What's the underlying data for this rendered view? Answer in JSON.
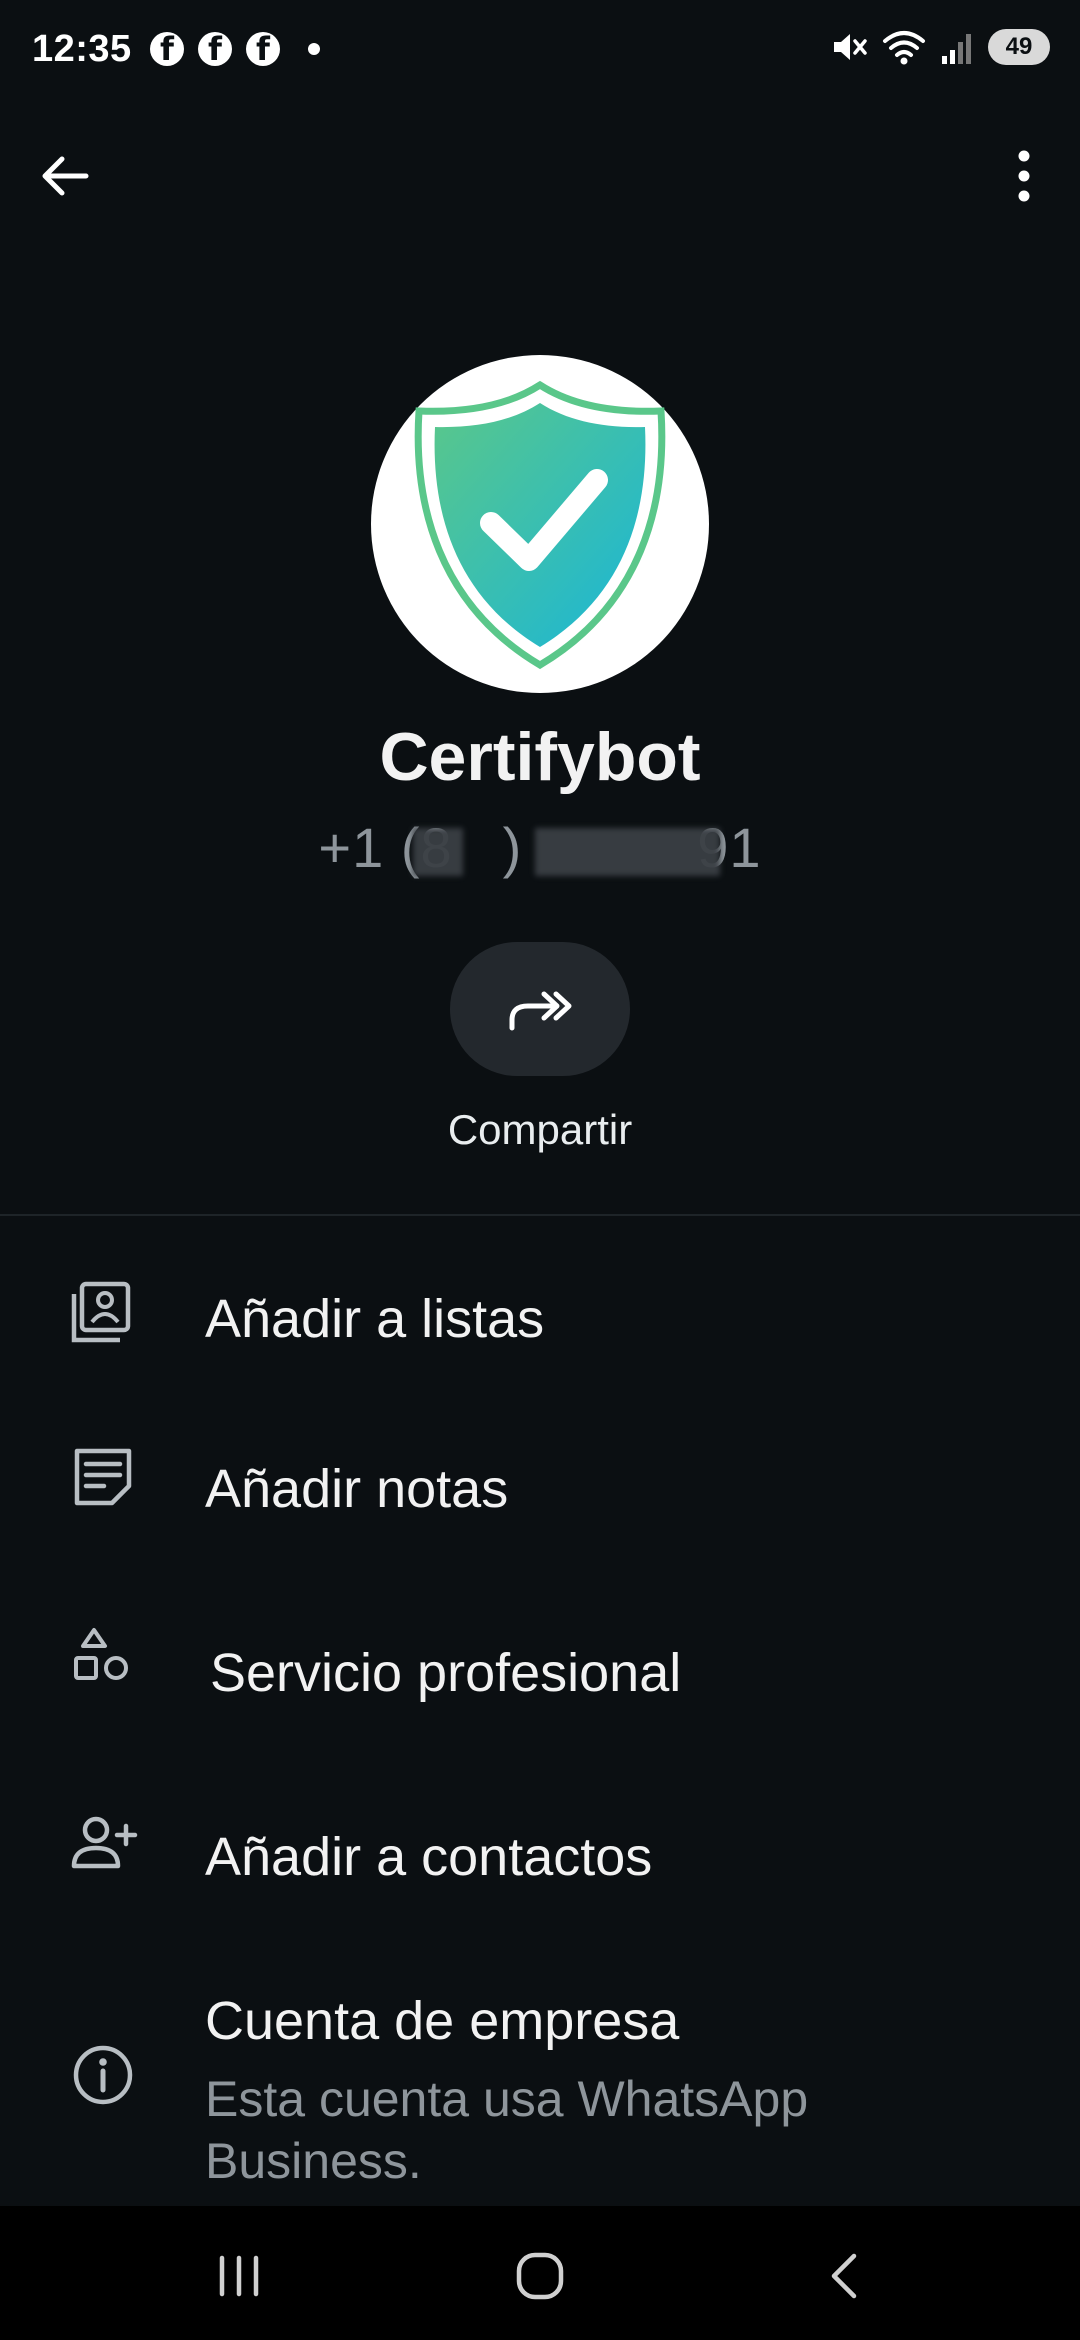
{
  "status_bar": {
    "time": "12:35",
    "battery": "49",
    "notification_icons": [
      "facebook-icon",
      "facebook-icon",
      "facebook-icon"
    ]
  },
  "app_bar": {
    "back_icon": "arrow-left-icon",
    "more_icon": "more-vert-icon"
  },
  "profile": {
    "name": "Certifybot",
    "phone_prefix": "+1 (8",
    "phone_mid": ")",
    "phone_suffix": "91",
    "avatar_icon": "shield-check-icon"
  },
  "actions": {
    "share_label": "Compartir",
    "share_icon": "share-forward-icon"
  },
  "menu": [
    {
      "label": "Añadir a listas",
      "icon": "lists-icon"
    },
    {
      "label": "Añadir notas",
      "icon": "notes-icon"
    },
    {
      "label": "Servicio profesional",
      "icon": "shapes-icon"
    },
    {
      "label": "Añadir a contactos",
      "icon": "add-person-icon"
    },
    {
      "label": "Cuenta de empresa",
      "sub": "Esta cuenta usa WhatsApp Business.",
      "icon": "info-icon"
    }
  ],
  "colors": {
    "background": "#0b0f12",
    "shield_green": "#5ac78a",
    "shield_blue": "#19b6d8"
  }
}
